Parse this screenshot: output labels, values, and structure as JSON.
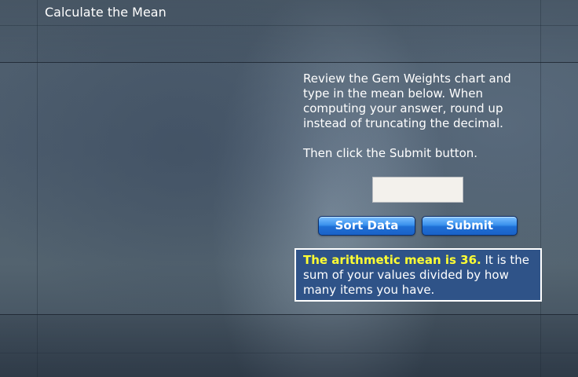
{
  "header": {
    "title": "Calculate the Mean"
  },
  "instructions": {
    "paragraph1": "Review the Gem Weights chart and type in the mean below. When computing your answer, round up instead of truncating the decimal.",
    "paragraph2": "Then click the Submit button."
  },
  "answer": {
    "value": "",
    "placeholder": ""
  },
  "buttons": {
    "sort_label": "Sort Data",
    "submit_label": "Submit"
  },
  "feedback": {
    "highlight": "The arithmetic mean is 36.",
    "text": " It is the sum of your values divided by how many items you have."
  },
  "colors": {
    "background": "#4c5c6d",
    "button": "#2a7fe6",
    "feedback_box": "#2f5388",
    "highlight": "#ffff33"
  }
}
